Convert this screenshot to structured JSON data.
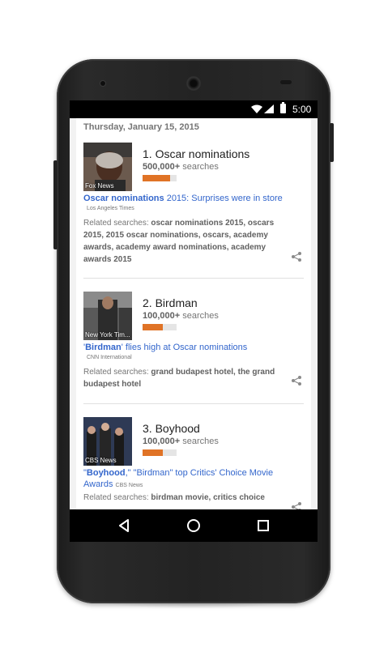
{
  "status_bar": {
    "time": "5:00"
  },
  "date": "Thursday, January 15, 2015",
  "trends": [
    {
      "rank_title": "1. Oscar nominations",
      "search_count": "500,000+",
      "search_suffix": " searches",
      "bar_fraction": 0.8,
      "image_source": "Fox News",
      "headline_bold": "Oscar nominations",
      "headline_rest": " 2015: Surprises were in store",
      "source": "Los Angeles Times",
      "related_prefix": "Related searches: ",
      "related_terms": "oscar nominations 2015, oscars 2015, 2015 oscar nominations, oscars, academy awards, academy award nominations, academy awards 2015"
    },
    {
      "rank_title": "2. Birdman",
      "search_count": "100,000+",
      "search_suffix": " searches",
      "bar_fraction": 0.6,
      "image_source": "New York Tim...",
      "headline_pre": "'",
      "headline_bold": "Birdman",
      "headline_rest": "' flies high at Oscar nominations",
      "source": "CNN International",
      "related_prefix": "Related searches: ",
      "related_terms": "grand budapest hotel, the grand budapest hotel"
    },
    {
      "rank_title": "3. Boyhood",
      "search_count": "100,000+",
      "search_suffix": " searches",
      "bar_fraction": 0.6,
      "image_source": "CBS News",
      "headline_pre": "\"",
      "headline_bold": "Boyhood",
      "headline_rest": ",\" \"Birdman\" top Critics' Choice Movie Awards",
      "source": "CBS News",
      "related_prefix": "Related searches: ",
      "related_terms": "birdman movie, critics choice"
    }
  ],
  "colors": {
    "accent_bar": "#e07326",
    "link": "#3366cc"
  },
  "icons": [
    "wifi-icon",
    "signal-icon",
    "battery-icon",
    "share-icon",
    "back-icon",
    "home-icon",
    "recents-icon"
  ]
}
